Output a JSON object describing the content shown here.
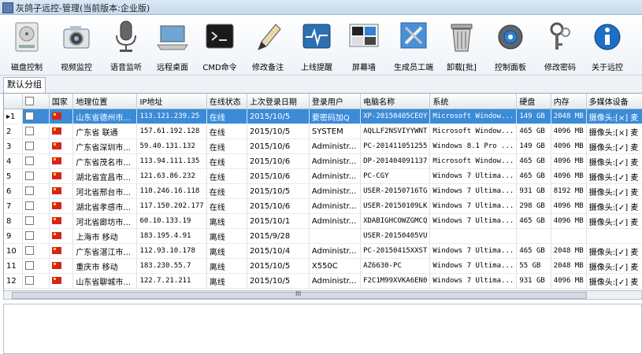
{
  "window": {
    "title": "灰鸽子远控-管理(当前版本:企业版)"
  },
  "toolbar": [
    {
      "label": "磁盘控制",
      "icon": "disk-icon"
    },
    {
      "label": "视频监控",
      "icon": "camera-icon"
    },
    {
      "label": "语音监听",
      "icon": "microphone-icon"
    },
    {
      "label": "远程桌面",
      "icon": "laptop-icon"
    },
    {
      "label": "CMD命令",
      "icon": "terminal-icon"
    },
    {
      "label": "修改备注",
      "icon": "pen-icon"
    },
    {
      "label": "上线提醒",
      "icon": "pulse-monitor-icon"
    },
    {
      "label": "屏幕墙",
      "icon": "screen-wall-icon"
    },
    {
      "label": "生成员工端",
      "icon": "tools-icon"
    },
    {
      "label": "卸载[批]",
      "icon": "trash-icon"
    },
    {
      "label": "控制面板",
      "icon": "gear-icon"
    },
    {
      "label": "修改密码",
      "icon": "keys-icon"
    },
    {
      "label": "关于远控",
      "icon": "info-icon"
    }
  ],
  "tabs": {
    "active": "默认分组"
  },
  "table": {
    "headers": [
      "国家",
      "地理位置",
      "IP地址",
      "在线状态",
      "上次登录日期",
      "登录用户",
      "电脑名称",
      "系统",
      "硬盘",
      "内存",
      "多媒体设备"
    ],
    "rows": [
      {
        "no": "1",
        "location": "山东省德州市...",
        "ip": "113.121.239.25",
        "status": "在线",
        "date": "2015/10/5",
        "user": "要密码加Q",
        "pc": "XP-20150405CEOY",
        "os": "Microsoft Window...",
        "disk": "149 GB",
        "mem": "2048 MB",
        "media": "摄像头:[×] 麦"
      },
      {
        "no": "2",
        "location": "广东省 联通",
        "ip": "157.61.192.128",
        "status": "在线",
        "date": "2015/10/5",
        "user": "SYSTEM",
        "pc": "AQLLF2NSVIYYWNT",
        "os": "Microsoft Window...",
        "disk": "465 GB",
        "mem": "4096 MB",
        "media": "摄像头:[×] 麦"
      },
      {
        "no": "3",
        "location": "广东省深圳市...",
        "ip": "59.40.131.132",
        "status": "在线",
        "date": "2015/10/6",
        "user": "Administr...",
        "pc": "PC-201411051255",
        "os": "Windows 8.1 Pro ...",
        "disk": "149 GB",
        "mem": "4096 MB",
        "media": "摄像头:[✓] 麦"
      },
      {
        "no": "4",
        "location": "广东省茂名市...",
        "ip": "113.94.111.135",
        "status": "在线",
        "date": "2015/10/6",
        "user": "Administr...",
        "pc": "DP-201404091137",
        "os": "Microsoft Window...",
        "disk": "465 GB",
        "mem": "4096 MB",
        "media": "摄像头:[✓] 麦"
      },
      {
        "no": "5",
        "location": "湖北省宜昌市...",
        "ip": "121.63.86.232",
        "status": "在线",
        "date": "2015/10/6",
        "user": "Administr...",
        "pc": "PC-CGY",
        "os": "Windows 7 Ultima...",
        "disk": "465 GB",
        "mem": "4096 MB",
        "media": "摄像头:[✓] 麦"
      },
      {
        "no": "6",
        "location": "河北省邢台市...",
        "ip": "110.246.16.118",
        "status": "在线",
        "date": "2015/10/5",
        "user": "Administr...",
        "pc": "USER-20150716TG",
        "os": "Windows 7 Ultima...",
        "disk": "931 GB",
        "mem": "8192 MB",
        "media": "摄像头:[✓] 麦"
      },
      {
        "no": "7",
        "location": "湖北省孝感市...",
        "ip": "117.150.202.177",
        "status": "在线",
        "date": "2015/10/6",
        "user": "Administr...",
        "pc": "USER-20150109LK",
        "os": "Windows 7 Ultima...",
        "disk": "298 GB",
        "mem": "4096 MB",
        "media": "摄像头:[✓] 麦"
      },
      {
        "no": "8",
        "location": "河北省廊坊市...",
        "ip": "60.10.133.19",
        "status": "离线",
        "date": "2015/10/1",
        "user": "Administr...",
        "pc": "XDABIGHCOWZGMCQ",
        "os": "Windows 7 Ultima...",
        "disk": "465 GB",
        "mem": "4096 MB",
        "media": "摄像头:[✓] 麦"
      },
      {
        "no": "9",
        "location": "上海市 移动",
        "ip": "183.195.4.91",
        "status": "离线",
        "date": "2015/9/28",
        "user": "",
        "pc": "USER-20150405VU",
        "os": "",
        "disk": "",
        "mem": "",
        "media": ""
      },
      {
        "no": "10",
        "location": "广东省湛江市...",
        "ip": "112.93.10.178",
        "status": "离线",
        "date": "2015/10/4",
        "user": "Administr...",
        "pc": "PC-20150415XXST",
        "os": "Windows 7 Ultima...",
        "disk": "465 GB",
        "mem": "2048 MB",
        "media": "摄像头:[✓] 麦"
      },
      {
        "no": "11",
        "location": "重庆市 移动",
        "ip": "183.230.55.7",
        "status": "离线",
        "date": "2015/10/5",
        "user": "X550C",
        "pc": "AZ6630-PC",
        "os": "Windows 7 Ultima...",
        "disk": "55 GB",
        "mem": "2048 MB",
        "media": "摄像头:[✓] 麦"
      },
      {
        "no": "12",
        "location": "山东省聊城市...",
        "ip": "122.7.21.211",
        "status": "离线",
        "date": "2015/10/5",
        "user": "Administr...",
        "pc": "F2C1M99XVKA6EN0",
        "os": "Windows 7 Ultima...",
        "disk": "931 GB",
        "mem": "4096 MB",
        "media": "摄像头:[✓] 麦"
      }
    ]
  },
  "scrollbar": {
    "grip": "III"
  },
  "colors": {
    "selection": "#3b8bd8",
    "flag": "#d8231c"
  }
}
